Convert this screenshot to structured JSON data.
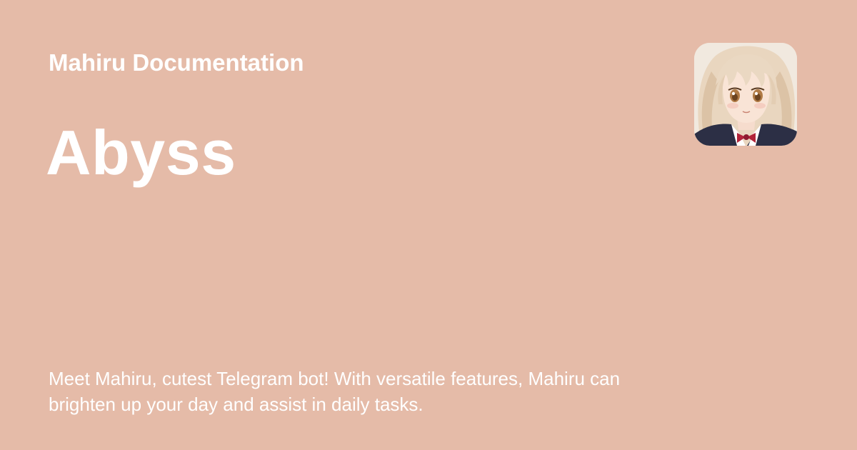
{
  "site": {
    "name": "Mahiru Documentation"
  },
  "page": {
    "title": "Abyss",
    "description": "Meet Mahiru, cutest Telegram bot! With versatile features, Mahiru can brighten up your day and assist in daily tasks."
  },
  "logo": {
    "icon": "anime-girl-avatar-icon"
  },
  "colors": {
    "background": "#e5bba8",
    "text": "#ffffff"
  }
}
